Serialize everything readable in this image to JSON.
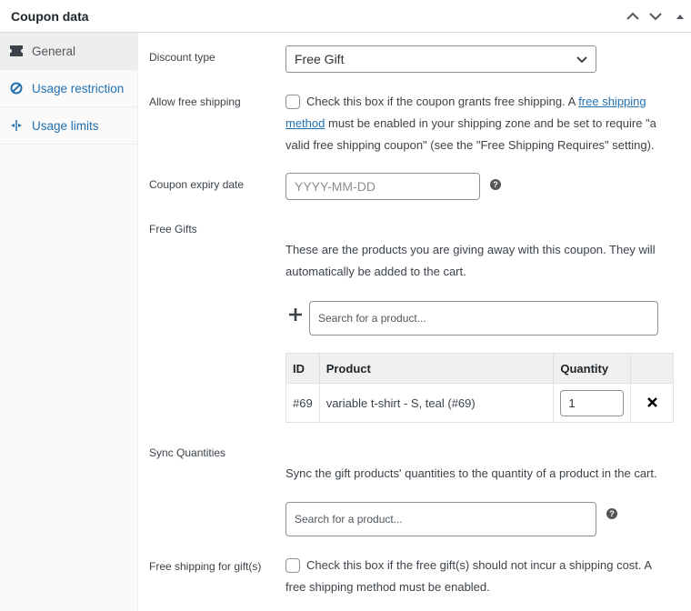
{
  "panel": {
    "title": "Coupon data"
  },
  "sidebar": {
    "items": [
      {
        "label": "General",
        "icon": "ticket-icon",
        "active": true
      },
      {
        "label": "Usage restriction",
        "icon": "no-entry-icon",
        "active": false
      },
      {
        "label": "Usage limits",
        "icon": "arrows-icon",
        "active": false
      }
    ]
  },
  "fields": {
    "discount_type": {
      "label": "Discount type",
      "value": "Free Gift"
    },
    "free_shipping": {
      "label": "Allow free shipping",
      "text_before": "Check this box if the coupon grants free shipping. A ",
      "link_line1": "free shipping",
      "link_line2": "method",
      "text_after_line2": " must be enabled in your shipping zone and be set to require \"a",
      "text_line3": "valid free shipping coupon\" (see the \"Free Shipping Requires\" setting).",
      "checked": false
    },
    "expiry": {
      "label": "Coupon expiry date",
      "placeholder": "YYYY-MM-DD"
    },
    "free_gifts": {
      "label": "Free Gifts",
      "description_line1": "These are the products you are giving away with this coupon. They will",
      "description_line2": "automatically be added to the cart.",
      "search_placeholder": "Search for a product...",
      "table": {
        "headers": [
          "ID",
          "Product",
          "Quantity",
          ""
        ],
        "rows": [
          {
            "id": "#69",
            "product": "variable t-shirt - S, teal (#69)",
            "quantity": "1"
          }
        ]
      }
    },
    "sync_quantities": {
      "label": "Sync Quantities",
      "description": "Sync the gift products' quantities to the quantity of a product in the cart.",
      "search_placeholder": "Search for a product..."
    },
    "free_shipping_gifts": {
      "label": "Free shipping for gift(s)",
      "text_line1": "Check this box if the free gift(s) should not incur a shipping cost. A",
      "text_line2": "free shipping method must be enabled.",
      "checked": false
    }
  },
  "colors": {
    "link": "#2271b1",
    "border": "#8c8f94",
    "active_tab_bg": "#eeeeee"
  }
}
